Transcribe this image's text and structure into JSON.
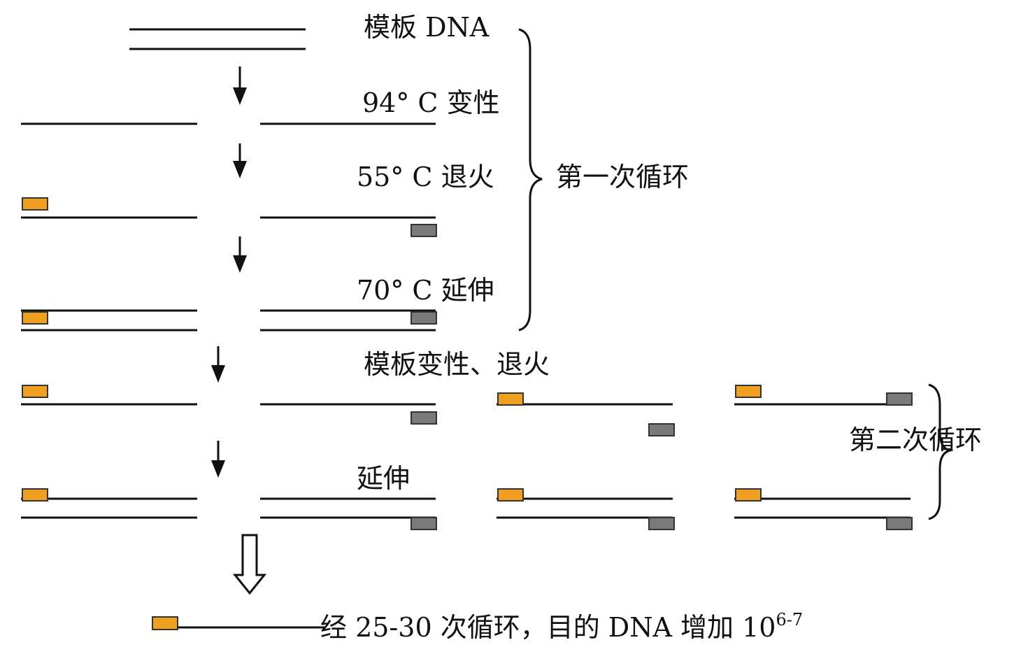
{
  "labels": {
    "template": "模板 DNA",
    "denature": "94° C 变性",
    "anneal": "55° C 退火",
    "extend": "70° C 延伸",
    "first_cycle": "第一次循环",
    "template_denature_anneal": "模板变性、退火",
    "extend2": "延伸",
    "second_cycle": "第二次循环",
    "result": "经 25-30 次循环，目的 DNA 增加 10",
    "result_exponent": "6-7"
  },
  "colors": {
    "strand": "#111111",
    "primer_orange": "#F0A020",
    "primer_gray": "#7A7A7A",
    "primer_border": "#333333"
  }
}
